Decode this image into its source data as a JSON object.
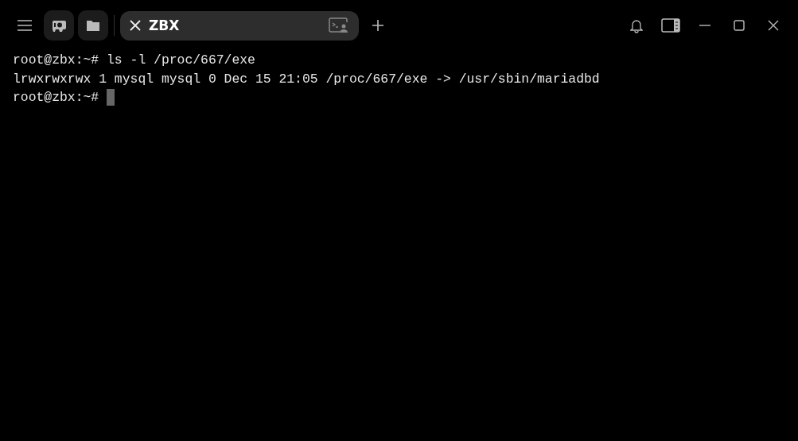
{
  "tab": {
    "title": "ZBX",
    "selected": true
  },
  "terminal": {
    "lines": [
      "root@zbx:~# ls -l /proc/667/exe",
      "lrwxrwxrwx 1 mysql mysql 0 Dec 15 21:05 /proc/667/exe -> /usr/sbin/mariadbd"
    ],
    "prompt": "root@zbx:~#"
  }
}
